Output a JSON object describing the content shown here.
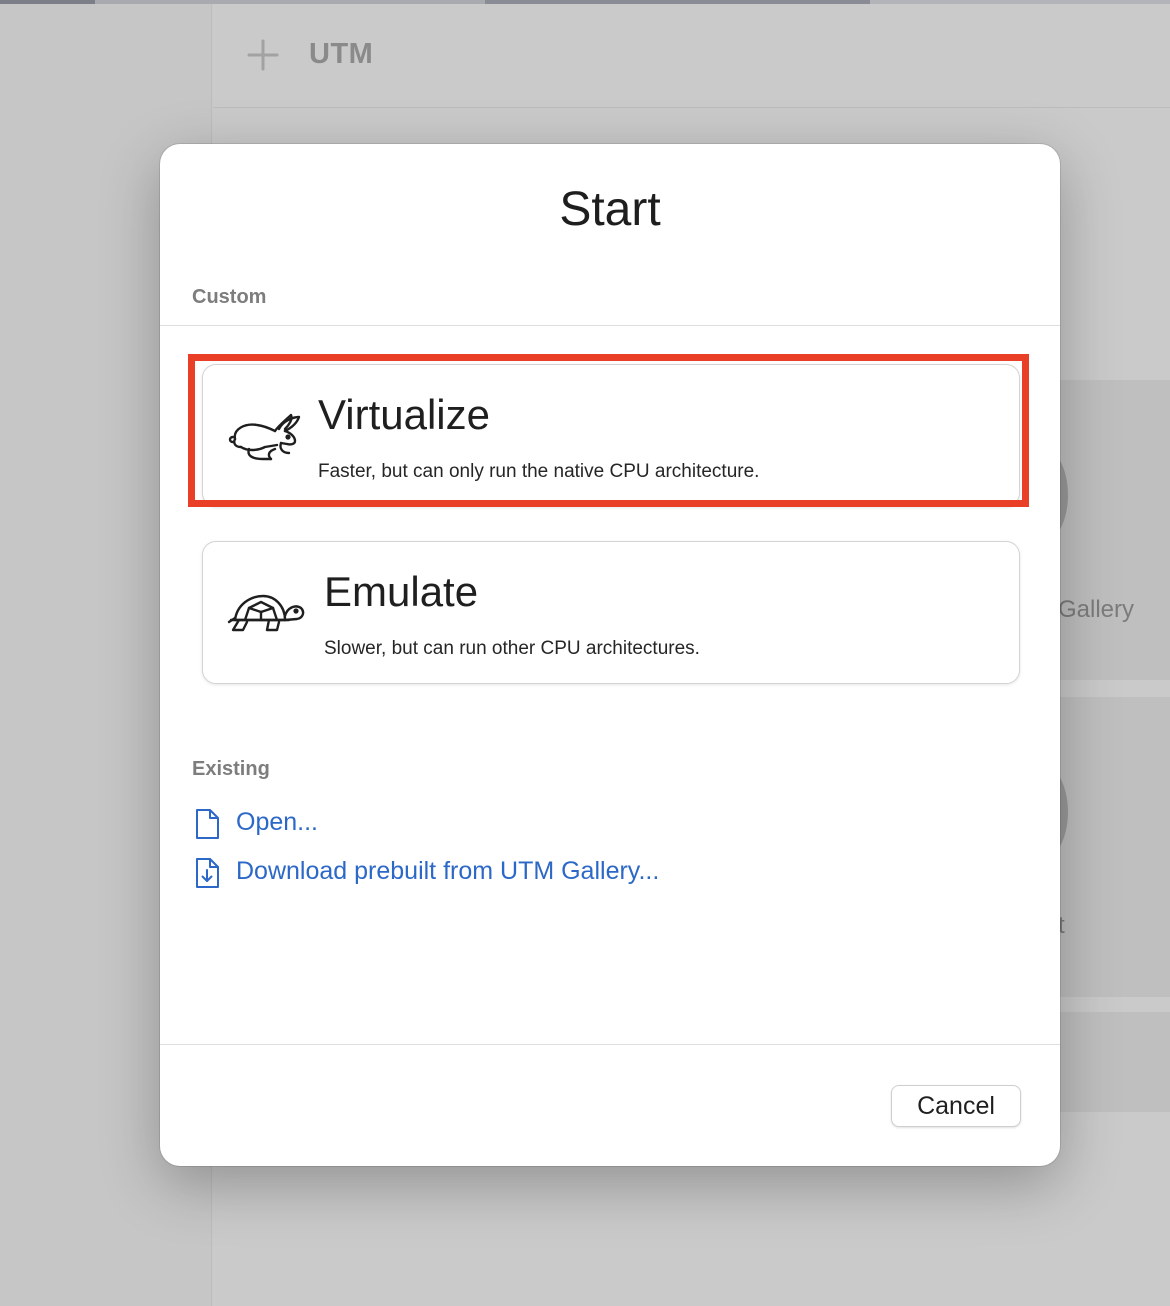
{
  "window": {
    "app_title": "UTM",
    "add_icon": "plus-icon"
  },
  "background": {
    "card_1_label": "Gallery",
    "card_2_label": "t"
  },
  "dialog": {
    "title": "Start",
    "custom_section": {
      "label": "Custom",
      "options": [
        {
          "title": "Virtualize",
          "description": "Faster, but can only run the native CPU architecture.",
          "icon": "rabbit-icon",
          "highlighted": true,
          "highlight_color": "#ea3f27"
        },
        {
          "title": "Emulate",
          "description": "Slower, but can run other CPU architectures.",
          "icon": "turtle-icon",
          "highlighted": false
        }
      ]
    },
    "existing_section": {
      "label": "Existing",
      "links": [
        {
          "label": "Open...",
          "icon": "document-icon"
        },
        {
          "label": "Download prebuilt from UTM Gallery...",
          "icon": "document-download-icon"
        }
      ]
    },
    "footer": {
      "cancel_label": "Cancel"
    }
  },
  "colors": {
    "link": "#2c68c7",
    "highlight": "#ea3f27",
    "section_label": "#7d7d7d"
  }
}
